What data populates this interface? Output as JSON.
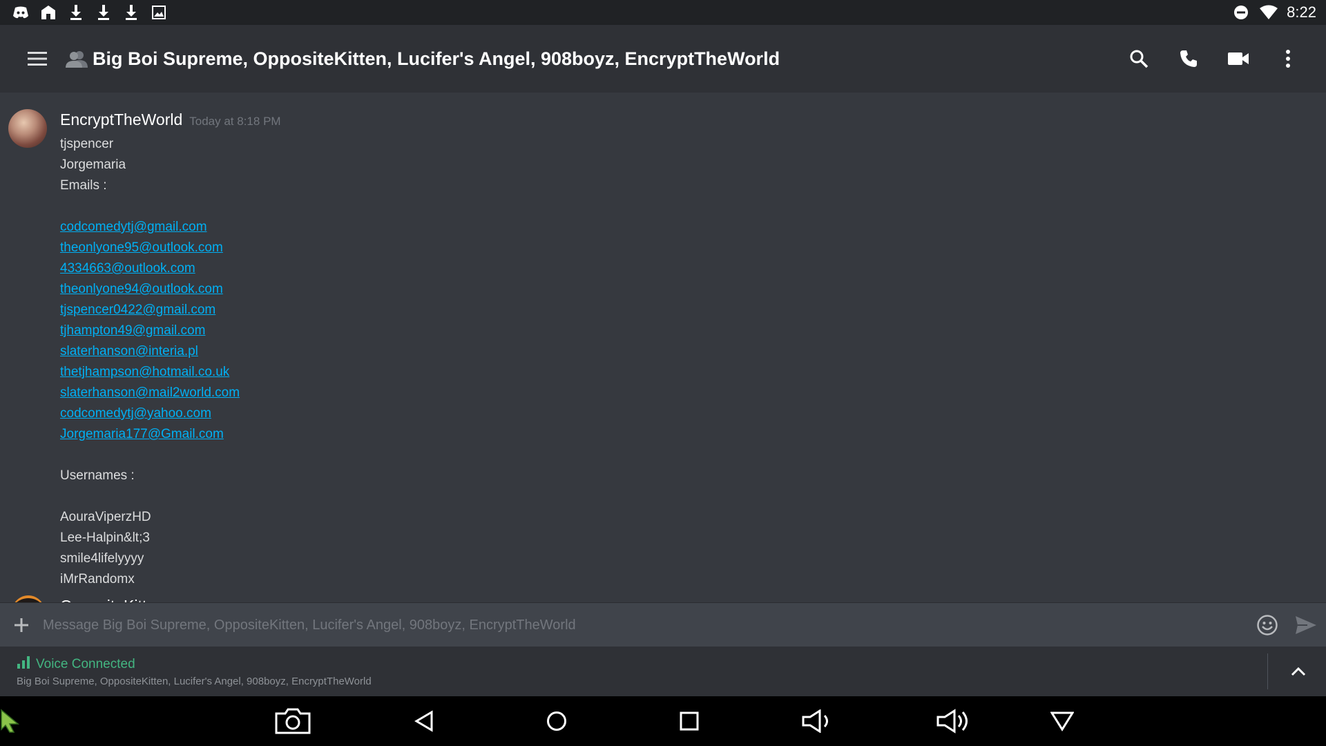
{
  "status_bar": {
    "time": "8:22",
    "left_icons": [
      "discord-icon",
      "home-icon",
      "download-icon",
      "download-icon",
      "download-icon",
      "image-icon"
    ],
    "right_icons": [
      "do-not-disturb-icon",
      "wifi-icon"
    ]
  },
  "header": {
    "title": "Big Boi Supreme, OppositeKitten, Lucifer's Angel, 908boyz, EncryptTheWorld",
    "actions": [
      "search-icon",
      "phone-icon",
      "video-icon",
      "more-vert-icon"
    ]
  },
  "message": {
    "author": "EncryptTheWorld",
    "timestamp": "Today at 8:18 PM",
    "lines": [
      {
        "text": "tjspencer",
        "type": "text"
      },
      {
        "text": "Jorgemaria",
        "type": "text"
      },
      {
        "text": "Emails :",
        "type": "text"
      },
      {
        "text": "",
        "type": "gap"
      },
      {
        "text": "codcomedytj@gmail.com",
        "type": "email"
      },
      {
        "text": "theonlyone95@outlook.com",
        "type": "email"
      },
      {
        "text": "4334663@outlook.com",
        "type": "email"
      },
      {
        "text": "theonlyone94@outlook.com",
        "type": "email"
      },
      {
        "text": "tjspencer0422@gmail.com",
        "type": "email"
      },
      {
        "text": "tjhampton49@gmail.com",
        "type": "email"
      },
      {
        "text": "slaterhanson@interia.pl",
        "type": "email"
      },
      {
        "text": "thetjhampson@hotmail.co.uk",
        "type": "email"
      },
      {
        "text": "slaterhanson@mail2world.com",
        "type": "email"
      },
      {
        "text": "codcomedytj@yahoo.com",
        "type": "email"
      },
      {
        "text": "Jorgemaria177@Gmail.com",
        "type": "email"
      },
      {
        "text": "",
        "type": "gap"
      },
      {
        "text": "Usernames :",
        "type": "text"
      },
      {
        "text": "",
        "type": "gap"
      },
      {
        "text": "AouraViperzHD",
        "type": "text"
      },
      {
        "text": "Lee-Halpin&lt;3",
        "type": "text"
      },
      {
        "text": "smile4lifelyyyy",
        "type": "text"
      },
      {
        "text": "iMrRandomx",
        "type": "text"
      }
    ]
  },
  "next_message": {
    "author": "OppositeKitten"
  },
  "composer": {
    "placeholder": "Message Big Boi Supreme, OppositeKitten, Lucifer's Angel, 908boyz, EncryptTheWorld"
  },
  "voice": {
    "status": "Voice Connected",
    "channel": "Big Boi Supreme, OppositeKitten, Lucifer's Angel, 908boyz, EncryptTheWorld"
  },
  "colors": {
    "link": "#00b0f4",
    "voice_green": "#43b581",
    "background": "#36393f",
    "header": "#2f3136"
  },
  "nav_bar": {
    "buttons": [
      "screenshot-icon",
      "back-icon",
      "home-icon",
      "recents-icon",
      "volume-down-icon",
      "volume-up-icon",
      "notifications-dropdown-icon"
    ]
  }
}
